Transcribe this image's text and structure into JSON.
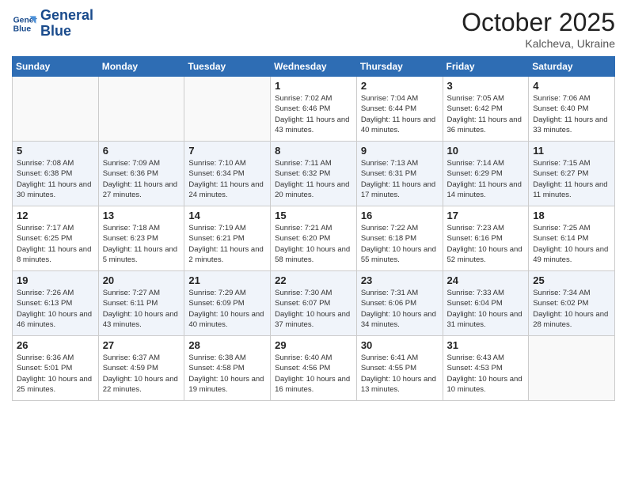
{
  "logo": {
    "line1": "General",
    "line2": "Blue"
  },
  "title": "October 2025",
  "subtitle": "Kalcheva, Ukraine",
  "weekdays": [
    "Sunday",
    "Monday",
    "Tuesday",
    "Wednesday",
    "Thursday",
    "Friday",
    "Saturday"
  ],
  "weeks": [
    [
      {
        "day": "",
        "info": ""
      },
      {
        "day": "",
        "info": ""
      },
      {
        "day": "",
        "info": ""
      },
      {
        "day": "1",
        "info": "Sunrise: 7:02 AM\nSunset: 6:46 PM\nDaylight: 11 hours and 43 minutes."
      },
      {
        "day": "2",
        "info": "Sunrise: 7:04 AM\nSunset: 6:44 PM\nDaylight: 11 hours and 40 minutes."
      },
      {
        "day": "3",
        "info": "Sunrise: 7:05 AM\nSunset: 6:42 PM\nDaylight: 11 hours and 36 minutes."
      },
      {
        "day": "4",
        "info": "Sunrise: 7:06 AM\nSunset: 6:40 PM\nDaylight: 11 hours and 33 minutes."
      }
    ],
    [
      {
        "day": "5",
        "info": "Sunrise: 7:08 AM\nSunset: 6:38 PM\nDaylight: 11 hours and 30 minutes."
      },
      {
        "day": "6",
        "info": "Sunrise: 7:09 AM\nSunset: 6:36 PM\nDaylight: 11 hours and 27 minutes."
      },
      {
        "day": "7",
        "info": "Sunrise: 7:10 AM\nSunset: 6:34 PM\nDaylight: 11 hours and 24 minutes."
      },
      {
        "day": "8",
        "info": "Sunrise: 7:11 AM\nSunset: 6:32 PM\nDaylight: 11 hours and 20 minutes."
      },
      {
        "day": "9",
        "info": "Sunrise: 7:13 AM\nSunset: 6:31 PM\nDaylight: 11 hours and 17 minutes."
      },
      {
        "day": "10",
        "info": "Sunrise: 7:14 AM\nSunset: 6:29 PM\nDaylight: 11 hours and 14 minutes."
      },
      {
        "day": "11",
        "info": "Sunrise: 7:15 AM\nSunset: 6:27 PM\nDaylight: 11 hours and 11 minutes."
      }
    ],
    [
      {
        "day": "12",
        "info": "Sunrise: 7:17 AM\nSunset: 6:25 PM\nDaylight: 11 hours and 8 minutes."
      },
      {
        "day": "13",
        "info": "Sunrise: 7:18 AM\nSunset: 6:23 PM\nDaylight: 11 hours and 5 minutes."
      },
      {
        "day": "14",
        "info": "Sunrise: 7:19 AM\nSunset: 6:21 PM\nDaylight: 11 hours and 2 minutes."
      },
      {
        "day": "15",
        "info": "Sunrise: 7:21 AM\nSunset: 6:20 PM\nDaylight: 10 hours and 58 minutes."
      },
      {
        "day": "16",
        "info": "Sunrise: 7:22 AM\nSunset: 6:18 PM\nDaylight: 10 hours and 55 minutes."
      },
      {
        "day": "17",
        "info": "Sunrise: 7:23 AM\nSunset: 6:16 PM\nDaylight: 10 hours and 52 minutes."
      },
      {
        "day": "18",
        "info": "Sunrise: 7:25 AM\nSunset: 6:14 PM\nDaylight: 10 hours and 49 minutes."
      }
    ],
    [
      {
        "day": "19",
        "info": "Sunrise: 7:26 AM\nSunset: 6:13 PM\nDaylight: 10 hours and 46 minutes."
      },
      {
        "day": "20",
        "info": "Sunrise: 7:27 AM\nSunset: 6:11 PM\nDaylight: 10 hours and 43 minutes."
      },
      {
        "day": "21",
        "info": "Sunrise: 7:29 AM\nSunset: 6:09 PM\nDaylight: 10 hours and 40 minutes."
      },
      {
        "day": "22",
        "info": "Sunrise: 7:30 AM\nSunset: 6:07 PM\nDaylight: 10 hours and 37 minutes."
      },
      {
        "day": "23",
        "info": "Sunrise: 7:31 AM\nSunset: 6:06 PM\nDaylight: 10 hours and 34 minutes."
      },
      {
        "day": "24",
        "info": "Sunrise: 7:33 AM\nSunset: 6:04 PM\nDaylight: 10 hours and 31 minutes."
      },
      {
        "day": "25",
        "info": "Sunrise: 7:34 AM\nSunset: 6:02 PM\nDaylight: 10 hours and 28 minutes."
      }
    ],
    [
      {
        "day": "26",
        "info": "Sunrise: 6:36 AM\nSunset: 5:01 PM\nDaylight: 10 hours and 25 minutes."
      },
      {
        "day": "27",
        "info": "Sunrise: 6:37 AM\nSunset: 4:59 PM\nDaylight: 10 hours and 22 minutes."
      },
      {
        "day": "28",
        "info": "Sunrise: 6:38 AM\nSunset: 4:58 PM\nDaylight: 10 hours and 19 minutes."
      },
      {
        "day": "29",
        "info": "Sunrise: 6:40 AM\nSunset: 4:56 PM\nDaylight: 10 hours and 16 minutes."
      },
      {
        "day": "30",
        "info": "Sunrise: 6:41 AM\nSunset: 4:55 PM\nDaylight: 10 hours and 13 minutes."
      },
      {
        "day": "31",
        "info": "Sunrise: 6:43 AM\nSunset: 4:53 PM\nDaylight: 10 hours and 10 minutes."
      },
      {
        "day": "",
        "info": ""
      }
    ]
  ]
}
